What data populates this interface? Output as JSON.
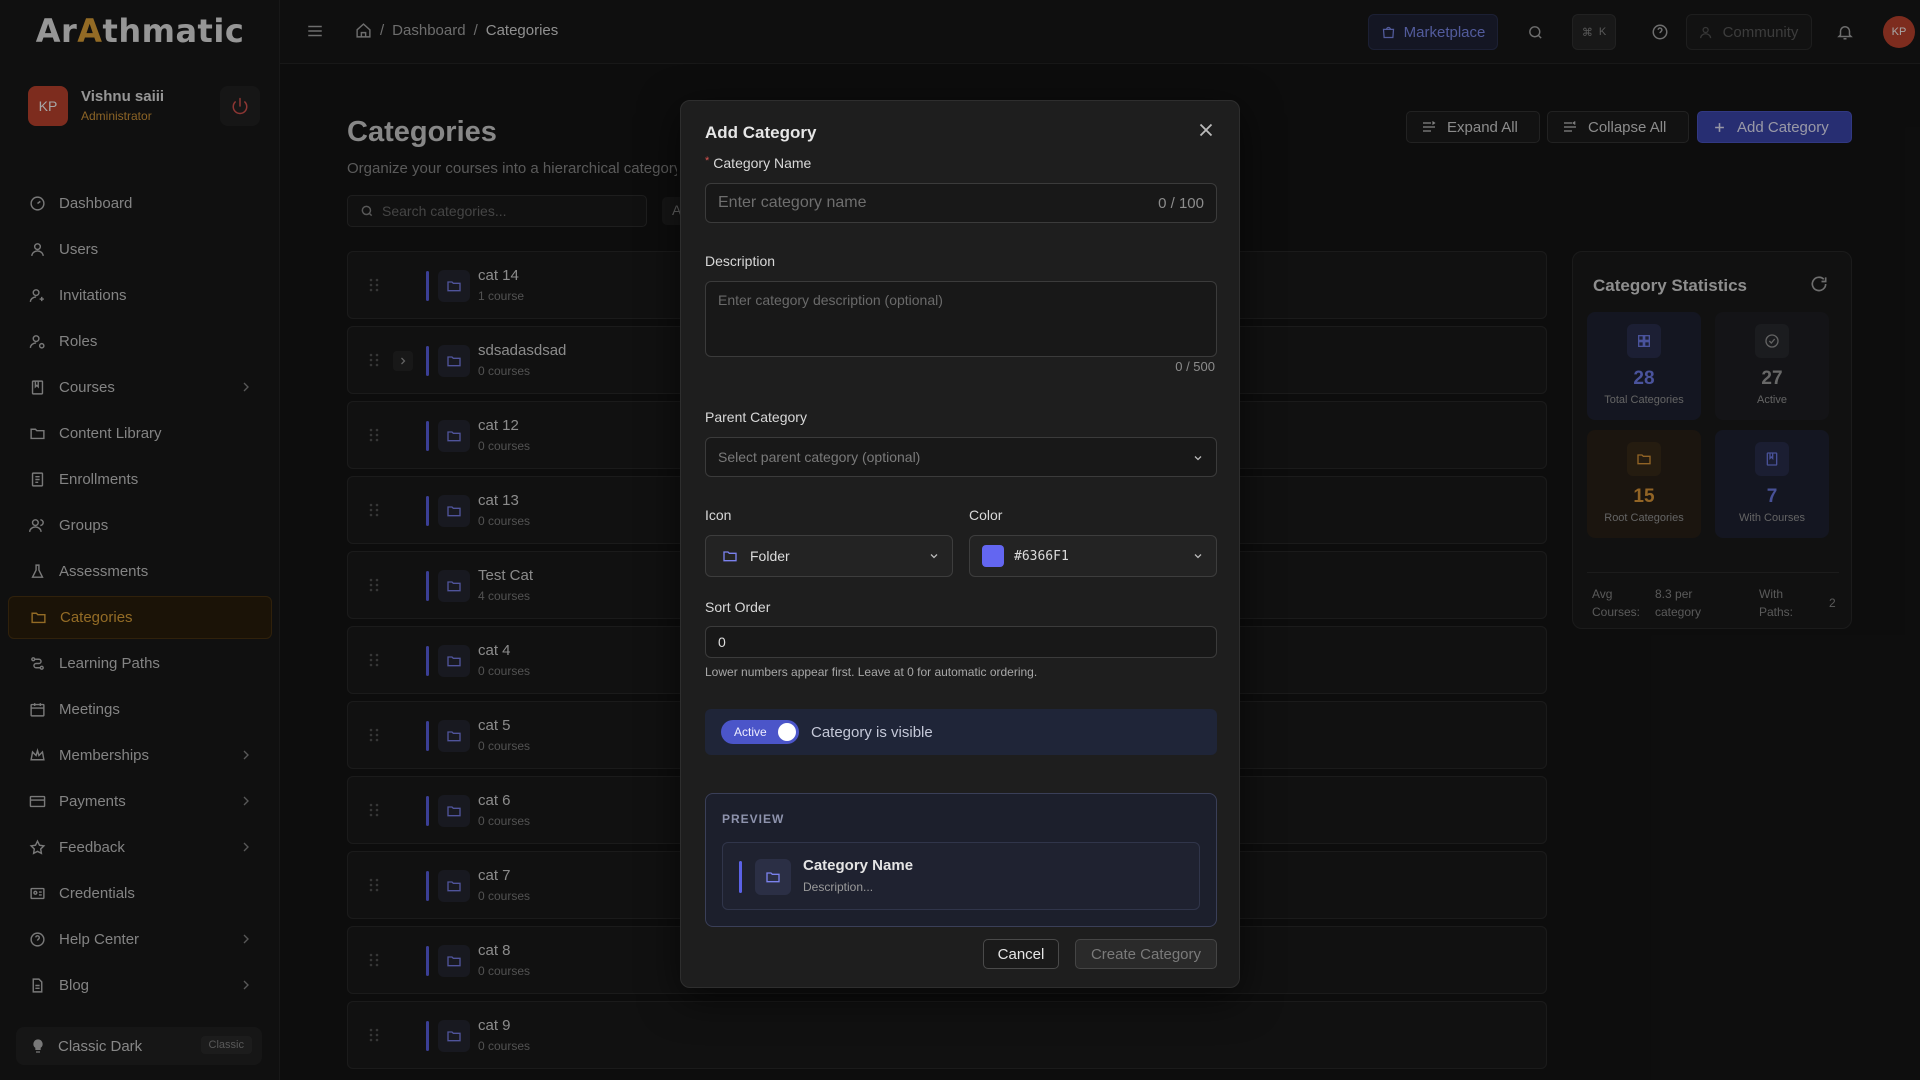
{
  "app": {
    "logo_pre": "Ar",
    "logo_accent": "A",
    "logo_post": "thmatic"
  },
  "user": {
    "initials": "KP",
    "name": "Vishnu saiii",
    "role": "Administrator"
  },
  "sidebar": {
    "items": [
      {
        "label": "Dashboard",
        "icon": "dashboard-icon"
      },
      {
        "label": "Users",
        "icon": "user-icon"
      },
      {
        "label": "Invitations",
        "icon": "user-plus-icon"
      },
      {
        "label": "Roles",
        "icon": "role-icon"
      },
      {
        "label": "Courses",
        "icon": "book-icon"
      },
      {
        "label": "Content Library",
        "icon": "folder-icon"
      },
      {
        "label": "Enrollments",
        "icon": "clipboard-icon"
      },
      {
        "label": "Groups",
        "icon": "group-icon"
      },
      {
        "label": "Assessments",
        "icon": "flask-icon"
      },
      {
        "label": "Categories",
        "icon": "folder-icon"
      },
      {
        "label": "Learning Paths",
        "icon": "path-icon"
      },
      {
        "label": "Meetings",
        "icon": "calendar-icon"
      },
      {
        "label": "Memberships",
        "icon": "crown-icon"
      },
      {
        "label": "Payments",
        "icon": "card-icon"
      },
      {
        "label": "Feedback",
        "icon": "star-icon"
      },
      {
        "label": "Credentials",
        "icon": "id-card-icon"
      },
      {
        "label": "Help Center",
        "icon": "help-icon"
      },
      {
        "label": "Blog",
        "icon": "document-icon"
      }
    ],
    "theme": {
      "label": "Classic Dark",
      "badge": "Classic"
    }
  },
  "topbar": {
    "breadcrumb": [
      "Dashboard",
      "Categories"
    ],
    "marketplace": "Marketplace",
    "kbd_cmd": "⌘",
    "kbd_key": "K",
    "community": "Community",
    "avatar": "KP"
  },
  "page": {
    "title": "Categories",
    "subtitle": "Organize your courses into a hierarchical category s",
    "search_placeholder": "Search categories...",
    "filter_label": "A",
    "expand_all": "Expand All",
    "collapse_all": "Collapse All",
    "add_category": "Add Category"
  },
  "categories": [
    {
      "name": "cat 14",
      "count": "1 course"
    },
    {
      "name": "sdsadasdsad",
      "count": "0 courses"
    },
    {
      "name": "cat 12",
      "count": "0 courses"
    },
    {
      "name": "cat 13",
      "count": "0 courses"
    },
    {
      "name": "Test Cat",
      "count": "4 courses"
    },
    {
      "name": "cat 4",
      "count": "0 courses"
    },
    {
      "name": "cat 5",
      "count": "0 courses"
    },
    {
      "name": "cat 6",
      "count": "0 courses"
    },
    {
      "name": "cat 7",
      "count": "0 courses"
    },
    {
      "name": "cat 8",
      "count": "0 courses"
    },
    {
      "name": "cat 9",
      "count": "0 courses"
    }
  ],
  "stats": {
    "title": "Category Statistics",
    "total": {
      "value": "28",
      "label": "Total Categories"
    },
    "active": {
      "value": "27",
      "label": "Active"
    },
    "root": {
      "value": "15",
      "label": "Root Categories"
    },
    "with_courses": {
      "value": "7",
      "label": "With Courses"
    },
    "avg_label_1": "Avg",
    "avg_label_2": "Courses:",
    "avg_value_1": "8.3 per",
    "avg_value_2": "category",
    "paths_label_1": "With",
    "paths_label_2": "Paths:",
    "paths_value": "2"
  },
  "modal": {
    "title": "Add Category",
    "name_label": "Category Name",
    "name_placeholder": "Enter category name",
    "name_counter": "0 / 100",
    "desc_label": "Description",
    "desc_placeholder": "Enter category description (optional)",
    "desc_counter": "0 / 500",
    "parent_label": "Parent Category",
    "parent_placeholder": "Select parent category (optional)",
    "icon_label": "Icon",
    "icon_value": "Folder",
    "color_label": "Color",
    "color_value": "#6366F1",
    "sort_label": "Sort Order",
    "sort_value": "0",
    "sort_hint": "Lower numbers appear first. Leave at 0 for automatic ordering.",
    "toggle_label": "Active",
    "visible_text": "Category is visible",
    "preview_title": "PREVIEW",
    "preview_name": "Category Name",
    "preview_desc": "Description...",
    "cancel": "Cancel",
    "create": "Create Category"
  },
  "colors": {
    "accent": "#6366F1",
    "brand_orange": "#E2A53A",
    "avatar": "#C0442F"
  }
}
